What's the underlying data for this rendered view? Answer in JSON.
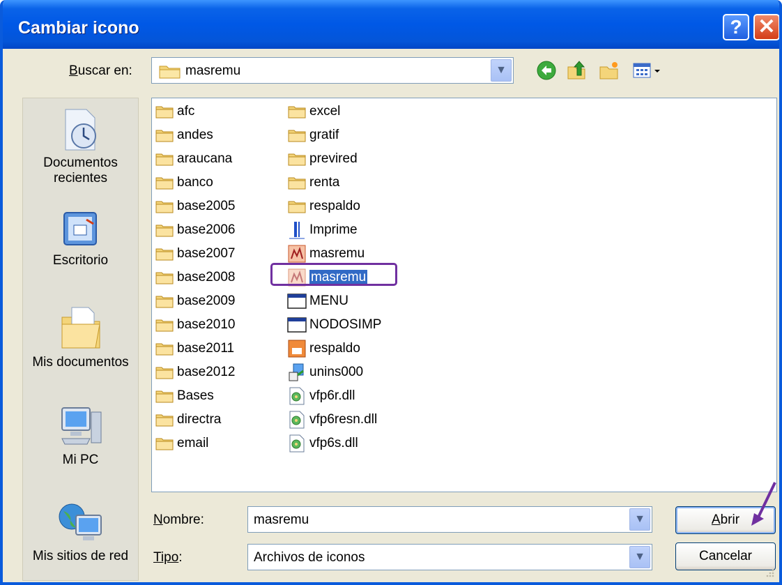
{
  "window": {
    "title": "Cambiar icono",
    "help_label": "?",
    "close_label": "✕"
  },
  "look_in": {
    "label_u": "B",
    "label_rest": "uscar en:",
    "value": "masremu"
  },
  "toolbar": {
    "icons": [
      "back-icon",
      "up-folder-icon",
      "new-folder-icon",
      "view-menu-icon"
    ]
  },
  "places": [
    {
      "label_line1": "Documentos",
      "label_line2": "recientes",
      "icon": "recent-documents-icon"
    },
    {
      "label_line1": "Escritorio",
      "label_line2": "",
      "icon": "desktop-icon"
    },
    {
      "label_line1": "Mis documentos",
      "label_line2": "",
      "icon": "my-documents-icon"
    },
    {
      "label_line1": "Mi PC",
      "label_line2": "",
      "icon": "my-computer-icon"
    },
    {
      "label_line1": "Mis sitios de red",
      "label_line2": "",
      "icon": "network-places-icon"
    }
  ],
  "files_col1": [
    "afc",
    "andes",
    "araucana",
    "banco",
    "base2005",
    "base2006",
    "base2007",
    "base2008",
    "base2009",
    "base2010",
    "base2011",
    "base2012",
    "Bases",
    "directra",
    "email"
  ],
  "files_col2": [
    {
      "name": "excel",
      "icon": "folder"
    },
    {
      "name": "gratif",
      "icon": "folder"
    },
    {
      "name": "previred",
      "icon": "folder"
    },
    {
      "name": "renta",
      "icon": "folder"
    },
    {
      "name": "respaldo",
      "icon": "folder"
    },
    {
      "name": "Imprime",
      "icon": "program"
    },
    {
      "name": "masremu",
      "icon": "app-icon"
    },
    {
      "name": "masremu",
      "icon": "app-icon",
      "selected": true
    },
    {
      "name": "MENU",
      "icon": "window-app"
    },
    {
      "name": "NODOSIMP",
      "icon": "window-app"
    },
    {
      "name": "respaldo",
      "icon": "app-icon-orange"
    },
    {
      "name": "unins000",
      "icon": "installer"
    },
    {
      "name": "vfp6r.dll",
      "icon": "dll"
    },
    {
      "name": "vfp6resn.dll",
      "icon": "dll"
    },
    {
      "name": "vfp6s.dll",
      "icon": "dll"
    }
  ],
  "name_field": {
    "label_u": "N",
    "label_rest": "ombre:",
    "value": "masremu"
  },
  "type_field": {
    "label_u": "Tipo",
    "label_rest": ":",
    "value": "Archivos de iconos"
  },
  "buttons": {
    "open_u": "A",
    "open_rest": "brir",
    "cancel": "Cancelar"
  },
  "colors": {
    "title_bar": "#0058E6",
    "selection": "#316AC5",
    "annotation": "#7030A0"
  }
}
